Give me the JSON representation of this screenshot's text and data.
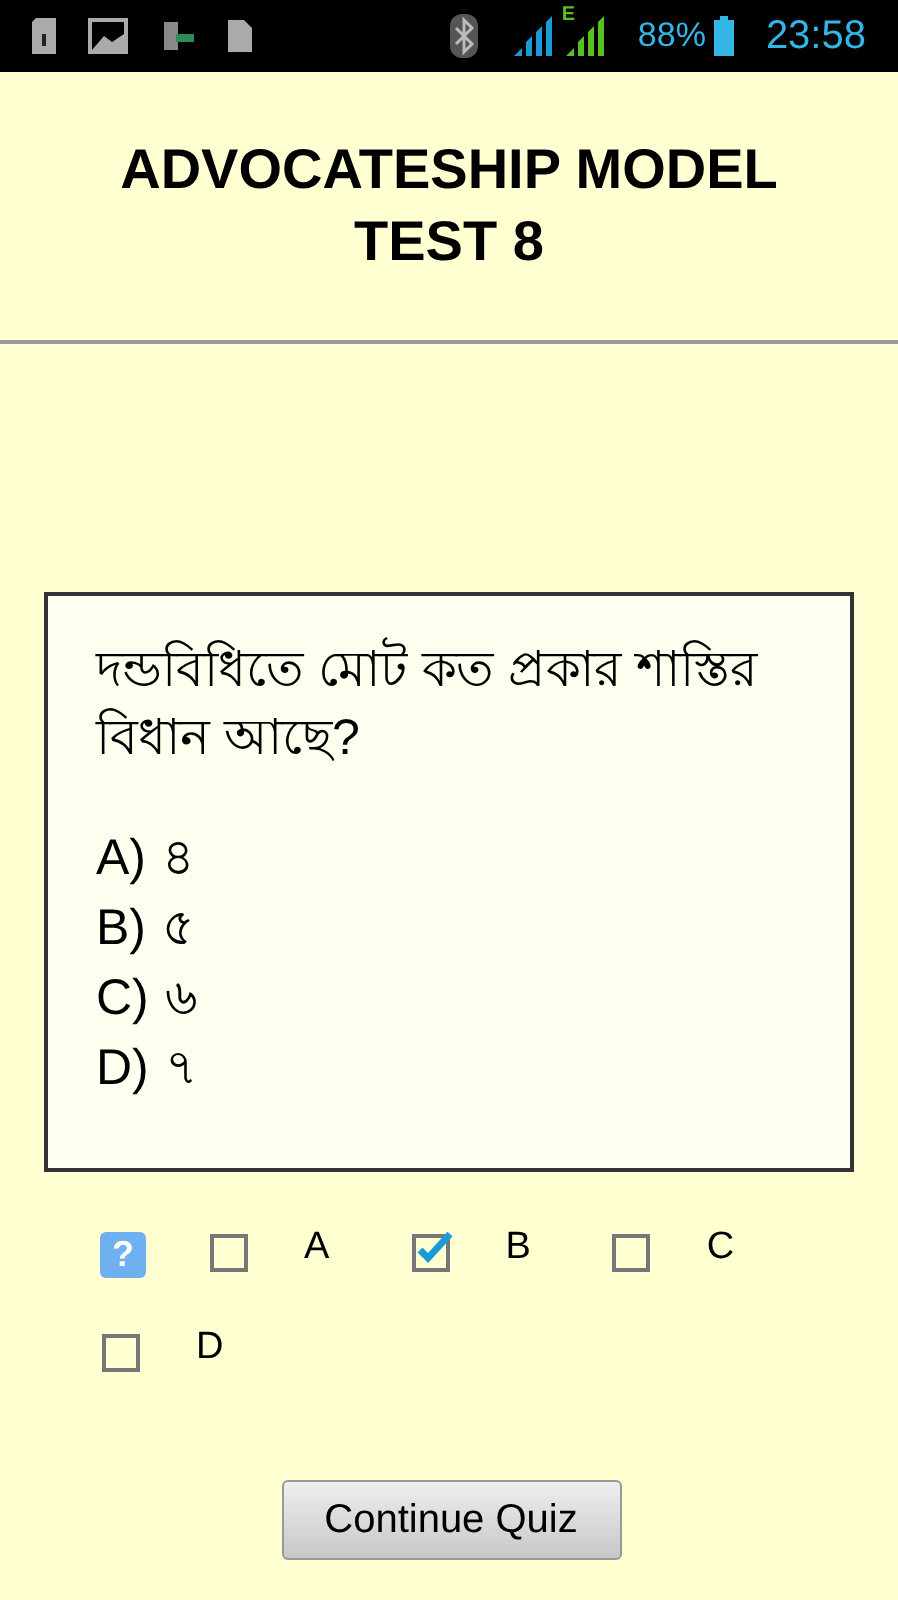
{
  "status_bar": {
    "battery": "88%",
    "time": "23:58",
    "network_type": "E"
  },
  "title": "ADVOCATESHIP MODEL TEST 8",
  "question": {
    "text": "দন্ডবিধিতে মোট কত প্রকার শাস্তির বিধান আছে?",
    "options": [
      {
        "letter": "A)",
        "text": "৪"
      },
      {
        "letter": "B)",
        "text": "৫"
      },
      {
        "letter": "C)",
        "text": "৬"
      },
      {
        "letter": "D)",
        "text": "৭"
      }
    ]
  },
  "answer": {
    "help": "?",
    "choices": [
      {
        "label": "A",
        "checked": false
      },
      {
        "label": "B",
        "checked": true
      },
      {
        "label": "C",
        "checked": false
      },
      {
        "label": "D",
        "checked": false
      }
    ]
  },
  "continue_button": "Continue Quiz"
}
